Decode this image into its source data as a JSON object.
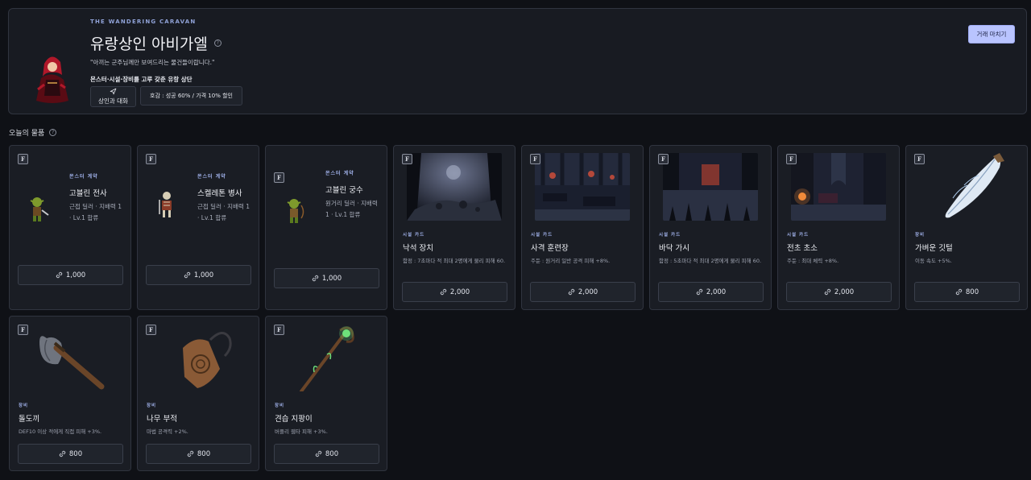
{
  "header": {
    "kicker": "THE WANDERING CARAVAN",
    "title": "유랑상인 아비가엘",
    "quote": "\"아끼는 군주님께만 보여드리는 물건들이랍니다.\"",
    "tagline": "몬스터·시설·장비를 고루 갖춘 유랑 상단",
    "talk_button": "상인과 대화",
    "affinity_info": "호감 : 성공 60% / 가격 10% 할인",
    "finish_button": "거래 마치기"
  },
  "section": {
    "title": "오늘의 물품"
  },
  "colors": {
    "accent": "#b9c4ff",
    "category": "#9fb0e8",
    "card_bg": "#1a1d24",
    "page_bg": "#0f1116"
  },
  "items": [
    {
      "badge": "F",
      "category": "몬스터 계약",
      "name": "고블린 전사",
      "desc": "근접 딜러 · 지배력 1 · Lv.1 합류",
      "price": "1,000",
      "icon": "goblin-warrior-sprite"
    },
    {
      "badge": "F",
      "category": "몬스터 계약",
      "name": "스켈레톤 병사",
      "desc": "근접 딜러 · 지배력 1 · Lv.1 합류",
      "price": "1,000",
      "icon": "skeleton-soldier-sprite"
    },
    {
      "badge": "F",
      "category": "몬스터 계약",
      "name": "고블린 궁수",
      "desc": "원거리 딜러 · 지배력 1 · Lv.1 합류",
      "price": "1,000",
      "icon": "goblin-archer-sprite"
    },
    {
      "badge": "F",
      "category": "시설 카드",
      "name": "낙석 장치",
      "desc": "함정 : 7초마다 적 최대 2명에게 물리 피해 60.",
      "price": "2,000",
      "icon": "rockfall-trap-image"
    },
    {
      "badge": "F",
      "category": "시설 카드",
      "name": "사격 훈련장",
      "desc": "주둔 : 원거리 일반 공격 피해 +8%.",
      "price": "2,000",
      "icon": "shooting-range-image"
    },
    {
      "badge": "F",
      "category": "시설 카드",
      "name": "바닥 가시",
      "desc": "함정 : 5초마다 적 최대 2명에게 물리 피해 60.",
      "price": "2,000",
      "icon": "floor-spikes-image"
    },
    {
      "badge": "F",
      "category": "시설 카드",
      "name": "전초 초소",
      "desc": "주둔 : 최대 체력 +8%.",
      "price": "2,000",
      "icon": "outpost-image"
    },
    {
      "badge": "F",
      "category": "장비",
      "name": "가벼운 깃털",
      "desc": "이동 속도 +5%.",
      "price": "800",
      "icon": "light-feather-image"
    },
    {
      "badge": "F",
      "category": "장비",
      "name": "돌도끼",
      "desc": "DEF10 이상 적에게 직접 피해 +3%.",
      "price": "800",
      "icon": "stone-axe-image"
    },
    {
      "badge": "F",
      "category": "장비",
      "name": "나무 부적",
      "desc": "마법 공격력 +2%.",
      "price": "800",
      "icon": "wooden-talisman-image"
    },
    {
      "badge": "F",
      "category": "장비",
      "name": "견습 지팡이",
      "desc": "버플리 웹타 피해 +3%.",
      "price": "800",
      "icon": "apprentice-staff-image"
    }
  ]
}
